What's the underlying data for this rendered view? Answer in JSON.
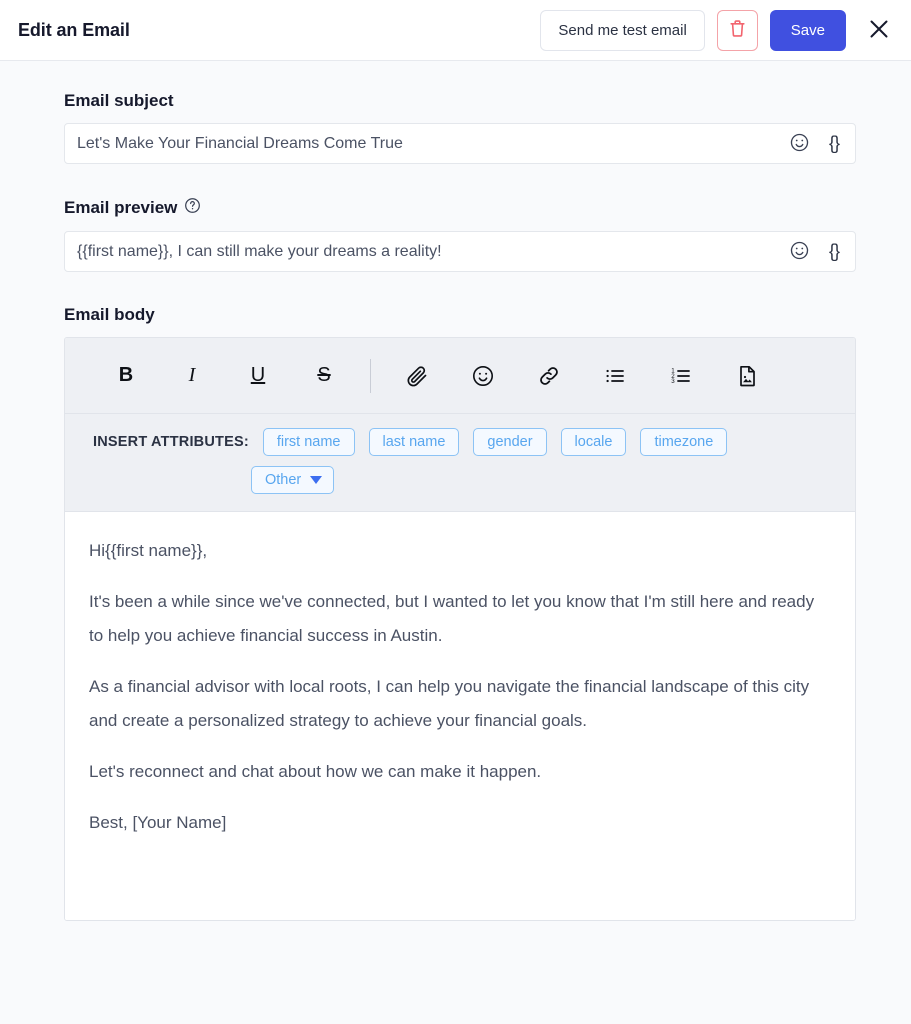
{
  "header": {
    "title": "Edit an Email",
    "test_email_label": "Send me test email",
    "delete_label": "delete-email",
    "save_label": "Save",
    "close_label": "close"
  },
  "subject": {
    "label": "Email subject",
    "value": "Let's Make Your Financial Dreams Come True",
    "placeholder": "Email subject",
    "emoji_icon": "smiley-icon",
    "merge_tag_icon": "{}"
  },
  "preview": {
    "label": "Email preview",
    "help_icon": "?",
    "value": "{{first name}}, I can still make your dreams a reality!",
    "placeholder": "Email preview",
    "emoji_icon": "smiley-icon",
    "merge_tag_icon": "{}"
  },
  "body": {
    "label": "Email body",
    "toolbar": [
      {
        "name": "bold-icon",
        "glyph": "B",
        "style": "bold"
      },
      {
        "name": "italic-icon",
        "glyph": "I",
        "style": "italic"
      },
      {
        "name": "underline-icon",
        "glyph": "U",
        "style": "underline"
      },
      {
        "name": "strikethrough-icon",
        "glyph": "S",
        "style": "strike"
      },
      {
        "name": "divider",
        "glyph": "",
        "style": "divider"
      },
      {
        "name": "attachment-icon",
        "glyph": "",
        "style": "svg-paperclip"
      },
      {
        "name": "emoji-icon",
        "glyph": "",
        "style": "svg-smiley"
      },
      {
        "name": "link-icon",
        "glyph": "",
        "style": "svg-link"
      },
      {
        "name": "bulleted-list-icon",
        "glyph": "",
        "style": "svg-ul"
      },
      {
        "name": "numbered-list-icon",
        "glyph": "",
        "style": "svg-ol"
      },
      {
        "name": "insert-image-icon",
        "glyph": "",
        "style": "svg-image"
      }
    ],
    "attributes_label": "INSERT ATTRIBUTES:",
    "attributes": [
      "first name",
      "last name",
      "gender",
      "locale",
      "timezone"
    ],
    "attributes_other": "Other",
    "paragraphs": [
      "Hi{{first name}},",
      "It's been a while since we've connected, but I wanted to let you know that I'm still here and ready to help you achieve financial success in Austin.",
      "As a financial advisor with local roots, I can help you navigate the financial landscape of this city and create a personalized strategy to achieve your financial goals.",
      "Let's reconnect and chat about how we can make it happen.",
      "Best, [Your Name]"
    ]
  },
  "colors": {
    "accent": "#4050e0",
    "danger": "#f4a3a8",
    "chip_text": "#58a6ef",
    "chip_border": "#8cc3f5",
    "page_bg": "#f9fafc",
    "toolbar_bg": "#eef0f4"
  }
}
